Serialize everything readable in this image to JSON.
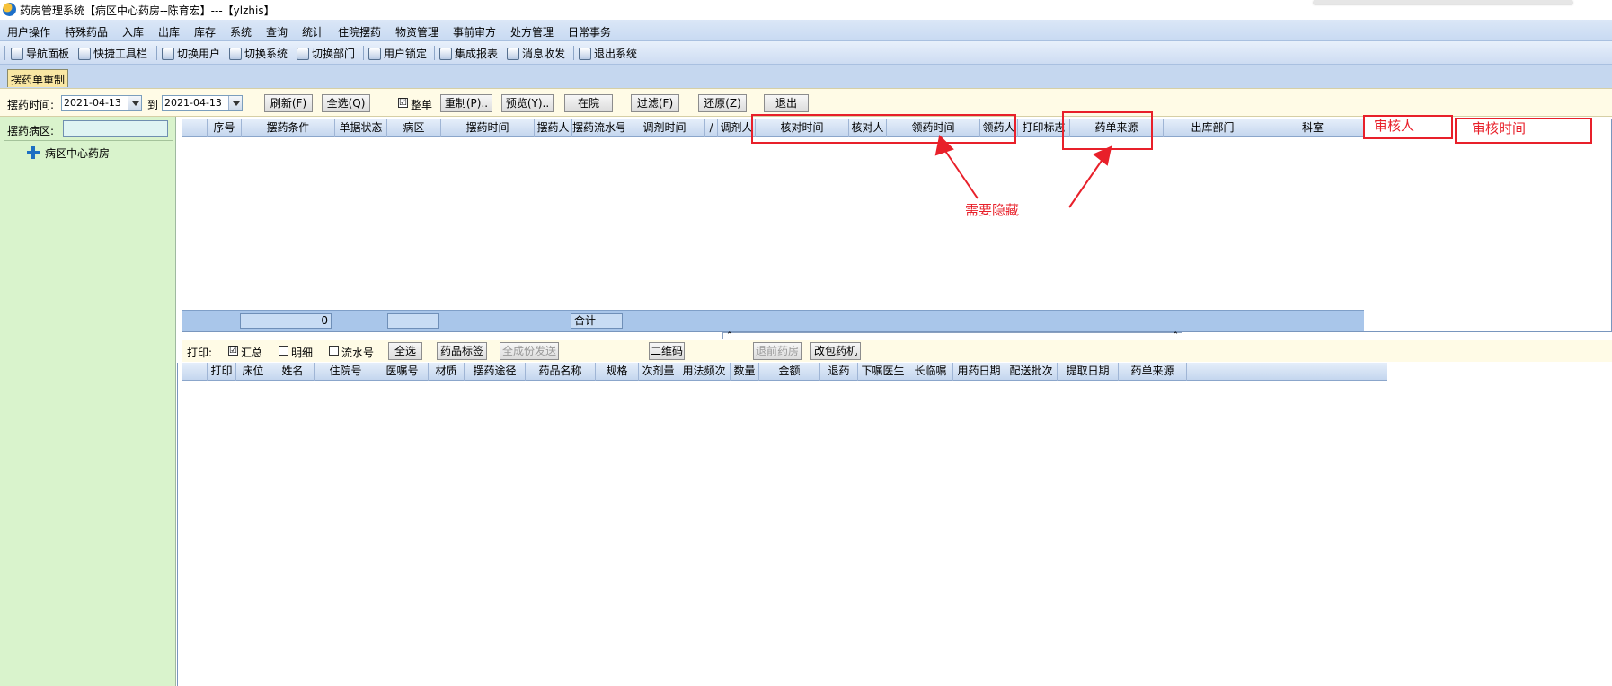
{
  "window": {
    "title": "药房管理系统【病区中心药房--陈育宏】---【ylzhis】"
  },
  "menu": [
    "用户操作",
    "特殊药品",
    "入库",
    "出库",
    "库存",
    "系统",
    "查询",
    "统计",
    "住院摆药",
    "物资管理",
    "事前审方",
    "处方管理",
    "日常事务"
  ],
  "toolbar": [
    "导航面板",
    "快捷工具栏",
    "切换用户",
    "切换系统",
    "切换部门",
    "用户锁定",
    "集成报表",
    "消息收发",
    "退出系统"
  ],
  "tab": {
    "label": "摆药单重制"
  },
  "filter": {
    "time_label": "摆药时间:",
    "date_from": "2021-04-13",
    "to_label": "到",
    "date_to": "2021-04-13",
    "refresh": "刷新(F)",
    "select_all": "全选(Q)",
    "whole_label": "整单",
    "whole_checked": "☑",
    "remake": "重制(P)..",
    "preview": "预览(Y)..",
    "in_hospital": "在院",
    "filter_btn": "过滤(F)",
    "restore": "还原(Z)",
    "exit": "退出"
  },
  "left": {
    "ward_label": "摆药病区:",
    "tree_item": "病区中心药房"
  },
  "upper_grid": {
    "columns": [
      "序号",
      "摆药条件",
      "单据状态",
      "病区",
      "摆药时间",
      "摆药人",
      "摆药流水号",
      "调剂时间",
      "/",
      "调剂人",
      "核对时间",
      "核对人",
      "领药时间",
      "领药人",
      "打印标志",
      "药单来源",
      "出库部门",
      "科室"
    ],
    "footer_count": "0",
    "footer_total": "合计"
  },
  "print_row": {
    "label": "打印:",
    "summary": "汇总",
    "summary_checked": "☑",
    "detail": "明细",
    "serial": "流水号",
    "select_all": "全选",
    "drug_label": "药品标签",
    "gen_send": "全成份发送",
    "qrcode": "二维码",
    "return_drug": "退前药房",
    "repack": "改包药机"
  },
  "lower_grid": {
    "columns": [
      "打印",
      "床位",
      "姓名",
      "住院号",
      "医嘱号",
      "材质",
      "摆药途径",
      "药品名称",
      "规格",
      "次剂量",
      "用法频次",
      "数量",
      "金额",
      "退药",
      "下嘱医生",
      "长临嘱",
      "用药日期",
      "配送批次",
      "提取日期",
      "药单来源"
    ]
  },
  "annotations": {
    "need_hide": "需要隐藏",
    "reviewer": "审核人",
    "review_time": "审核时间",
    "color": "#e8202a"
  }
}
